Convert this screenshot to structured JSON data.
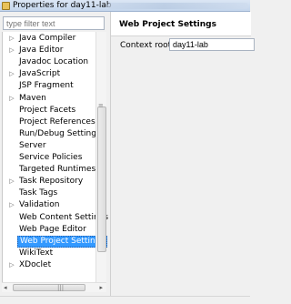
{
  "window": {
    "title": "Properties for day11-lab"
  },
  "filter": {
    "placeholder": "type filter text"
  },
  "tree": {
    "items": [
      {
        "label": "Java Compiler",
        "expandable": true
      },
      {
        "label": "Java Editor",
        "expandable": true
      },
      {
        "label": "Javadoc Location",
        "expandable": false
      },
      {
        "label": "JavaScript",
        "expandable": true
      },
      {
        "label": "JSP Fragment",
        "expandable": false
      },
      {
        "label": "Maven",
        "expandable": true
      },
      {
        "label": "Project Facets",
        "expandable": false
      },
      {
        "label": "Project References",
        "expandable": false
      },
      {
        "label": "Run/Debug Settings",
        "expandable": false
      },
      {
        "label": "Server",
        "expandable": false
      },
      {
        "label": "Service Policies",
        "expandable": false
      },
      {
        "label": "Targeted Runtimes",
        "expandable": false
      },
      {
        "label": "Task Repository",
        "expandable": true
      },
      {
        "label": "Task Tags",
        "expandable": false
      },
      {
        "label": "Validation",
        "expandable": true
      },
      {
        "label": "Web Content Settings",
        "expandable": false
      },
      {
        "label": "Web Page Editor",
        "expandable": false
      },
      {
        "label": "Web Project Settings",
        "expandable": false,
        "selected": true
      },
      {
        "label": "WikiText",
        "expandable": false
      },
      {
        "label": "XDoclet",
        "expandable": true
      }
    ]
  },
  "panel": {
    "heading": "Web Project Settings",
    "context_root_label": "Context root:",
    "context_root_value": "day11-lab"
  },
  "icons": {
    "expand": "▷",
    "scroll_left": "◂",
    "scroll_right": "▸",
    "grip_vertical": "≡",
    "grip_horizontal": "|||"
  },
  "colors": {
    "selection": "#3399ff"
  }
}
